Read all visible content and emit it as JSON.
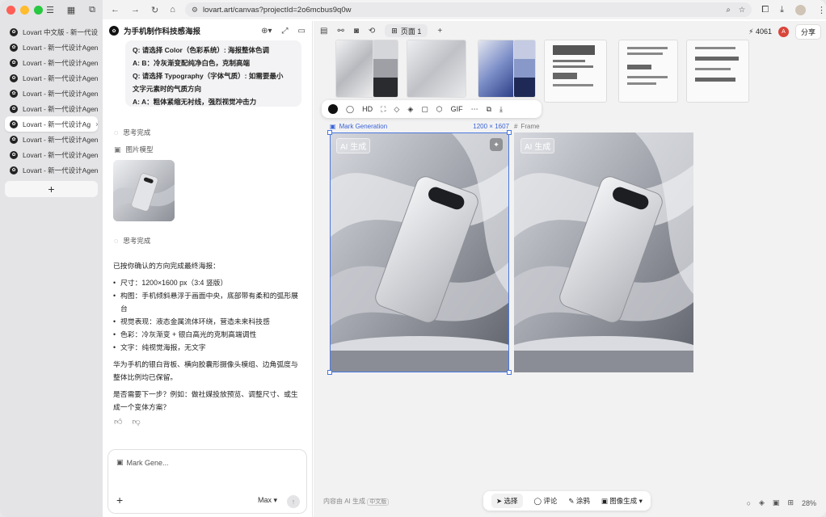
{
  "tabs": [
    {
      "label": "Lovart 中文版 - 新一代设计",
      "active": false
    },
    {
      "label": "Lovart - 新一代设计Agent",
      "active": false
    },
    {
      "label": "Lovart - 新一代设计Agent",
      "active": false
    },
    {
      "label": "Lovart - 新一代设计Agent",
      "active": false
    },
    {
      "label": "Lovart - 新一代设计Agent",
      "active": false
    },
    {
      "label": "Lovart - 新一代设计Agent",
      "active": false
    },
    {
      "label": "Lovart - 新一代设计Ag",
      "active": true
    },
    {
      "label": "Lovart - 新一代设计Agent",
      "active": false
    },
    {
      "label": "Lovart - 新一代设计Agent",
      "active": false
    },
    {
      "label": "Lovart - 新一代设计Agent",
      "active": false
    }
  ],
  "browser": {
    "url": "lovart.art/canvas?projectId=2o6mcbus9q0w"
  },
  "chat": {
    "title": "为手机制作科技感海报",
    "qa": [
      "Q: 请选择 Color（色彩系统）: 海报整体色调",
      "A: B：冷灰渐变配纯净白色，克制高端",
      "Q: 请选择 Typography（字体气质）: 如需要最小",
      "文字元素时的气质方向",
      "A: A：粗体紧缩无衬线，强烈视觉冲击力"
    ],
    "status1": "思考完成",
    "model_label": "图片模型",
    "status2": "思考完成",
    "intro": "已按你确认的方向完成最终海报：",
    "bullets": [
      "尺寸：1200×1600 px（3:4 竖版）",
      "构图：手机倾斜悬浮于画面中央，底部带有柔和的弧形展台",
      "视觉表现：液态金属流体环绕，营造未来科技感",
      "色彩：冷灰渐变 + 银白高光的克制高端调性",
      "文字：纯视觉海报，无文字"
    ],
    "para1": "华为手机的银白背板、横向胶囊形摄像头模组、边角弧度与整体比例均已保留。",
    "para2": "是否需要下一步？例如：做社媒投放预览、调整尺寸、或生成一个变体方案？",
    "input_chip": "Mark Gene...",
    "model": "Max"
  },
  "canvas": {
    "page": "页面 1",
    "credits": "4061",
    "share": "分享",
    "avatar": "A",
    "frame1_name": "Mark Generation",
    "frame1_size": "1200 × 1607",
    "frame2_name": "Frame",
    "ai_tag": "AI 生成",
    "footer_note": "内容由 AI 生成",
    "footer_badge": "中文版",
    "zoom": "28%",
    "tools": {
      "select": "选择",
      "comment": "评论",
      "draw": "涂鸦",
      "image": "图像生成"
    }
  }
}
